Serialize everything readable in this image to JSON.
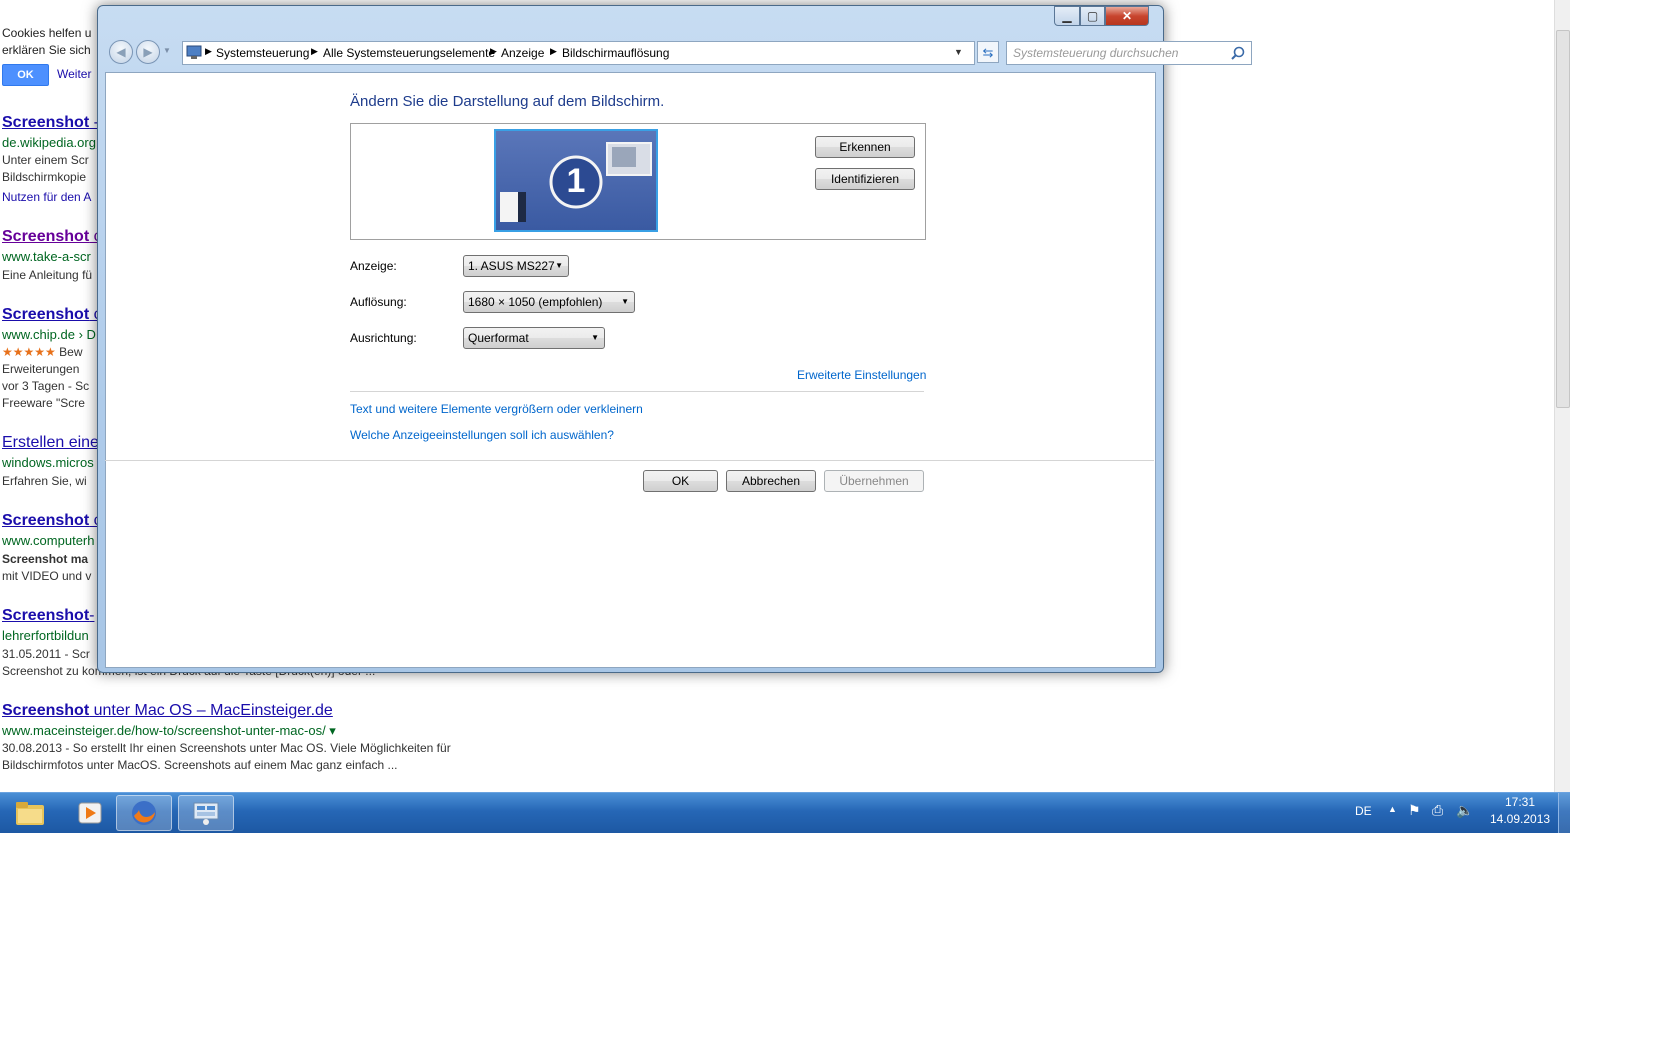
{
  "browser": {
    "cookie_text_1": "Cookies helfen u",
    "cookie_text_2": "erklären Sie sich",
    "cookie_ok": "OK",
    "cookie_more": "Weiter",
    "results": [
      {
        "title_bold": "Screenshot",
        "title_rest": " -",
        "url": "de.wikipedia.org",
        "snippet_1": "Unter einem Scr",
        "snippet_2": "Bildschirmkopie",
        "snippet_3": "Nutzen für den A"
      },
      {
        "title_bold": "Screenshot",
        "title_rest": " c",
        "url": "www.take-a-scr",
        "snippet_1": "Eine Anleitung fü"
      },
      {
        "title_bold": "Screenshot",
        "title_rest": " c",
        "url": "www.chip.de › D",
        "rating": "★★★★★",
        "snippet_1": "Bew",
        "snippet_2": "Erweiterungen",
        "snippet_3": "vor 3 Tagen - Sc",
        "snippet_4": "Freeware \"Scre"
      },
      {
        "title_bold": "",
        "title_rest": "Erstellen eine",
        "url": "windows.micros",
        "snippet_1": "Erfahren Sie, wi"
      },
      {
        "title_bold": "Screenshot",
        "title_rest": " c",
        "url": "www.computerh",
        "snippet_1": "Screenshot ma",
        "snippet_2": "mit VIDEO und v"
      },
      {
        "title_bold": "Screenshot",
        "title_rest": "-",
        "url": "lehrerfortbildun",
        "snippet_1": "31.05.2011 - Scr",
        "snippet_2": "Screenshot zu kommen, ist ein Druck auf die Taste [Druck(en)] oder ..."
      },
      {
        "title_bold": "Screenshot",
        "title_rest": " unter Mac OS – MacEinsteiger.de",
        "url": "www.maceinsteiger.de/how-to/screenshot-unter-mac-os/ ▾",
        "snippet_1": "30.08.2013 - So erstellt Ihr einen Screenshots unter Mac OS. Viele Möglichkeiten für",
        "snippet_2": "Bildschirmfotos unter MacOS. Screenshots auf einem Mac ganz einfach ..."
      }
    ]
  },
  "window": {
    "caption_minimize": "▁",
    "caption_maximize": "▢",
    "caption_close": "✕",
    "breadcrumbs": [
      "Systemsteuerung",
      "Alle Systemsteuerungselemente",
      "Anzeige",
      "Bildschirmauflösung"
    ],
    "search_placeholder": "Systemsteuerung durchsuchen",
    "heading": "Ändern Sie die Darstellung auf dem Bildschirm.",
    "monitor_number": "1",
    "btn_detect": "Erkennen",
    "btn_identify": "Identifizieren",
    "label_display": "Anzeige:",
    "value_display": "1. ASUS MS227",
    "label_resolution": "Auflösung:",
    "value_resolution": "1680 × 1050 (empfohlen)",
    "label_orientation": "Ausrichtung:",
    "value_orientation": "Querformat",
    "link_advanced": "Erweiterte Einstellungen",
    "link_text_size": "Text und weitere Elemente vergrößern oder verkleinern",
    "link_which": "Welche Anzeigeeinstellungen soll ich auswählen?",
    "btn_ok": "OK",
    "btn_cancel": "Abbrechen",
    "btn_apply": "Übernehmen"
  },
  "taskbar": {
    "language": "DE",
    "time": "17:31",
    "date": "14.09.2013"
  },
  "colors": {
    "accent_blue": "#1e3c8c",
    "link_blue": "#0066cc",
    "taskbar_blue": "#2667b6",
    "result_url_green": "#006621"
  }
}
